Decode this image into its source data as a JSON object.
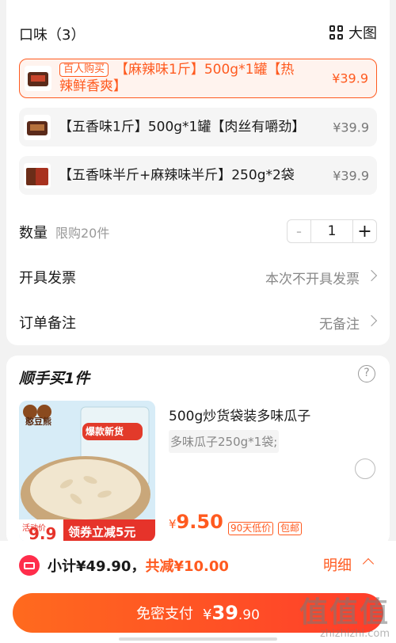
{
  "flavors": {
    "title": "口味（3）",
    "view_toggle": "大图",
    "options": [
      {
        "tag": "百人购买",
        "text": "【麻辣味1斤】500g*1罐【热辣鲜香爽】",
        "price": "¥39.9",
        "selected": true
      },
      {
        "text": "【五香味1斤】500g*1罐【肉丝有嚼劲】",
        "price": "¥39.9",
        "selected": false
      },
      {
        "text": "【五香味半斤+麻辣味半斤】250g*2袋",
        "price": "¥39.9",
        "selected": false
      }
    ]
  },
  "quantity": {
    "label": "数量",
    "limit": "限购20件",
    "minus": "-",
    "value": "1",
    "plus": "+"
  },
  "invoice": {
    "label": "开具发票",
    "value": "本次不开具发票"
  },
  "remark": {
    "label": "订单备注",
    "value": "无备注"
  },
  "addon": {
    "title": "顺手买1件",
    "help": "?",
    "product": {
      "name": "500g炒货袋装多味瓜子",
      "spec": "多味瓜子250g*1袋;",
      "price_symbol": "¥",
      "price": "9.50",
      "tags": [
        "90天低价",
        "包邮"
      ],
      "image": {
        "brand": "憨豆熊",
        "badge": "爆款新货",
        "promo": "领券立减5元",
        "activity": "活动价",
        "promo_price": "9.9"
      }
    }
  },
  "summary": {
    "subtotal": "小计¥49.90，",
    "discount": "共减¥10.00",
    "detail": "明细",
    "pay_label": "免密支付",
    "pay_currency": "¥",
    "pay_amount": "39",
    "pay_decimal": ".90"
  },
  "watermark": {
    "big": "值值值",
    "small": "zhizhizhi.com"
  }
}
